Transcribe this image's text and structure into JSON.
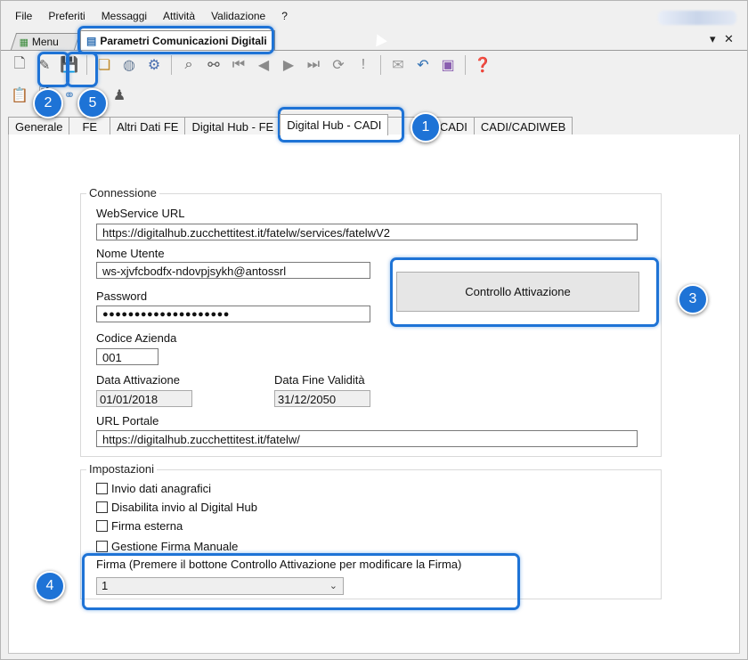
{
  "menubar": [
    "File",
    "Preferiti",
    "Messaggi",
    "Attività",
    "Validazione",
    "?"
  ],
  "doc_tabs": {
    "menu": "Menu",
    "active": "Parametri Comunicazioni Digitali"
  },
  "window_controls": {
    "dropdown": "▾",
    "close": "✕"
  },
  "page_tabs": [
    "Generale",
    "FE",
    "Altri Dati FE",
    "Digital Hub - FE",
    "Digital Hub - CADI",
    "TEL/CADI",
    "CADI/CADIWEB"
  ],
  "connessione": {
    "legend": "Connessione",
    "ws_url_label": "WebService URL",
    "ws_url": "https://digitalhub.zucchettitest.it/fatelw/services/fatelwV2",
    "user_label": "Nome Utente",
    "user": "ws-xjvfcbodfx-ndovpjsykh@antossrl",
    "password_label": "Password",
    "password": "●●●●●●●●●●●●●●●●●●●●",
    "azienda_label": "Codice Azienda",
    "azienda": "001",
    "data_att_label": "Data Attivazione",
    "data_att": "01/01/2018",
    "data_fine_label": "Data Fine Validità",
    "data_fine": "31/12/2050",
    "url_portale_label": "URL Portale",
    "url_portale": "https://digitalhub.zucchettitest.it/fatelw/",
    "button": "Controllo Attivazione"
  },
  "impostazioni": {
    "legend": "Impostazioni",
    "checks": [
      "Invio dati anagrafici",
      "Disabilita invio al Digital Hub",
      "Firma esterna",
      "Gestione Firma Manuale"
    ],
    "firma_label": "Firma (Premere il bottone Controllo Attivazione per modificare la Firma)",
    "firma_value": "1"
  },
  "badges": [
    "1",
    "2",
    "3",
    "4",
    "5"
  ],
  "colors": {
    "accent": "#1e73d6"
  }
}
